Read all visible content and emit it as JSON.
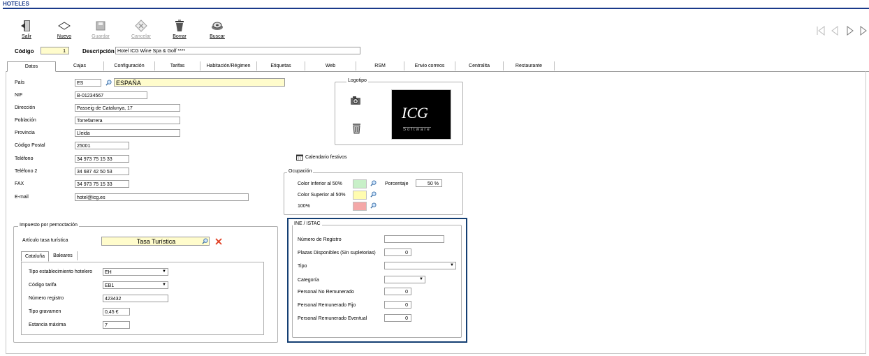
{
  "window": {
    "title": "HOTELES"
  },
  "toolbar": {
    "salir": "Salir",
    "nuevo": "Nuevo",
    "guardar": "Guardar",
    "cancelar": "Cancelar",
    "borrar": "Borrar",
    "buscar": "Buscar"
  },
  "header": {
    "codigo_label": "Código",
    "codigo_value": "1",
    "descripcion_label": "Descripción",
    "descripcion_value": "Hotel ICG Wine Spa & Golf ****"
  },
  "tabs": [
    "Datos",
    "Cajas",
    "Configuración",
    "Tarifas",
    "Habitación/Régimen",
    "Etiquetas",
    "Web",
    "RSM",
    "Envio correos",
    "Centralita",
    "Restaurante"
  ],
  "datos": {
    "pais_label": "País",
    "pais_code": "ES",
    "pais_name": "ESPAÑA",
    "nif_label": "NIF",
    "nif_value": "B-01234567",
    "direccion_label": "Dirección",
    "direccion_value": "Passeig de Catalunya, 17",
    "poblacion_label": "Población",
    "poblacion_value": "Torrefarrera",
    "provincia_label": "Provincia",
    "provincia_value": "Lleida",
    "cp_label": "Código Postal",
    "cp_value": "25001",
    "telefono_label": "Teléfono",
    "telefono_value": "34 973 75 15 33",
    "telefono2_label": "Teléfono 2",
    "telefono2_value": "34 687 42 50 53",
    "fax_label": "FAX",
    "fax_value": "34 973 75 15 33",
    "email_label": "E-mail",
    "email_value": "hotel@icg.es"
  },
  "logotipo": {
    "title": "Logotipo",
    "logo_text": "ICG",
    "logo_sub": "Software"
  },
  "calendario": {
    "label": "Calendario festivos"
  },
  "ocupacion": {
    "title": "Ocupación",
    "inferior_label": "Color Inferior al 50%",
    "superior_label": "Color Superior al 50%",
    "cien_label": "100%",
    "porcentaje_label": "Porcentaje",
    "porcentaje_value": "50 %",
    "colors": {
      "inferior": "#c8f0c8",
      "superior": "#fffcb0",
      "cien": "#f4a8a8"
    }
  },
  "impuesto": {
    "title": "Impuesto por pernoctación",
    "articulo_label": "Artículo tasa turística",
    "articulo_value": "Tasa Turística",
    "subtabs": [
      "Cataluña",
      "Baleares"
    ],
    "tipo_est_label": "Tipo establecimiento hotelero",
    "tipo_est_value": "EH",
    "codigo_tarifa_label": "Código tarifa",
    "codigo_tarifa_value": "EB1",
    "num_registro_label": "Número registro",
    "num_registro_value": "423432",
    "tipo_gravamen_label": "Tipo gravamen",
    "tipo_gravamen_value": "0,45 €",
    "estancia_label": "Estancia máxima",
    "estancia_value": "7"
  },
  "ine": {
    "title": "INE / ISTAC",
    "num_registro_label": "Número de Registro",
    "num_registro_value": "",
    "plazas_label": "Plazas Disponibles (Sin supletorias)",
    "plazas_value": "0",
    "tipo_label": "Tipo",
    "tipo_value": "",
    "categoria_label": "Categoría",
    "categoria_value": "",
    "no_remun_label": "Personal No Remunerado",
    "no_remun_value": "0",
    "remun_fijo_label": "Personal Remunerado Fijo",
    "remun_fijo_value": "0",
    "remun_event_label": "Personal Remunerado Eventual",
    "remun_event_value": "0",
    "border_color": "#143f73"
  }
}
